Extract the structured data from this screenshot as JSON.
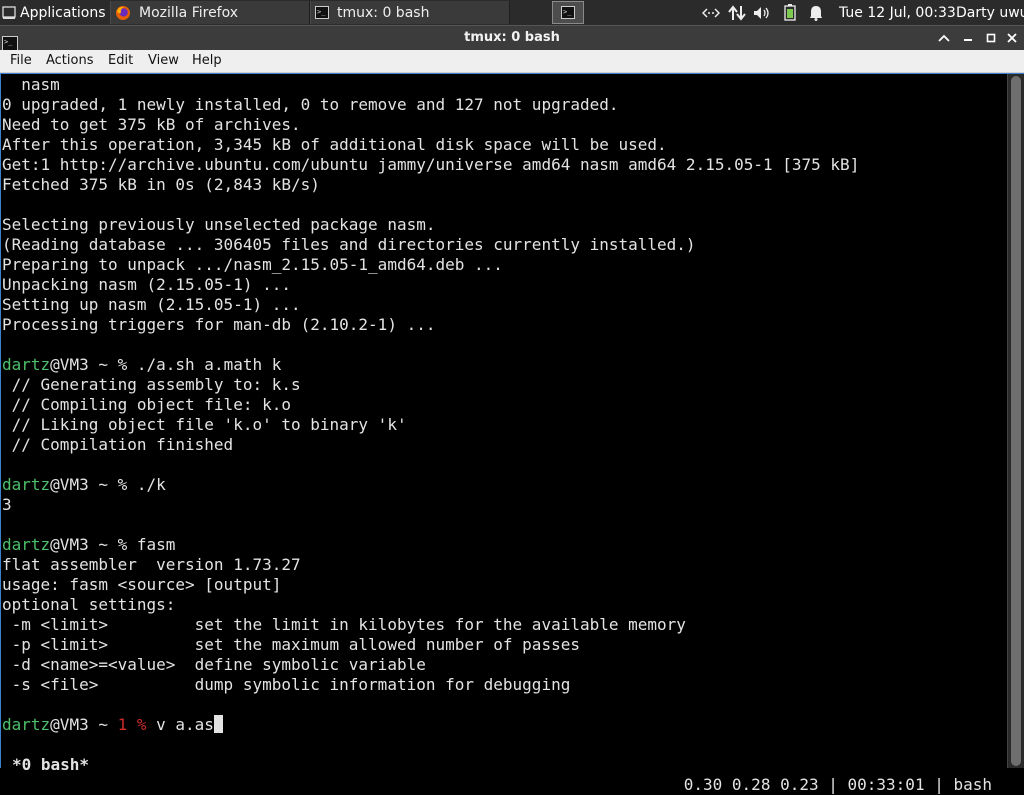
{
  "panel": {
    "applications_label": "Applications",
    "tasks": [
      {
        "label": "Mozilla Firefox",
        "icon": "firefox-icon"
      },
      {
        "label": "tmux: 0 bash",
        "icon": "terminal-icon"
      }
    ],
    "clock": "Tue 12 Jul, 00:33",
    "user": "Darty uwu"
  },
  "window": {
    "title": "tmux: 0 bash"
  },
  "menu": {
    "items": [
      "File",
      "Actions",
      "Edit",
      "View",
      "Help"
    ]
  },
  "terminal": {
    "lines": [
      "  nasm",
      "0 upgraded, 1 newly installed, 0 to remove and 127 not upgraded.",
      "Need to get 375 kB of archives.",
      "After this operation, 3,345 kB of additional disk space will be used.",
      "Get:1 http://archive.ubuntu.com/ubuntu jammy/universe amd64 nasm amd64 2.15.05-1 [375 kB]",
      "Fetched 375 kB in 0s (2,843 kB/s)",
      "",
      "Selecting previously unselected package nasm.",
      "(Reading database ... 306405 files and directories currently installed.)",
      "Preparing to unpack .../nasm_2.15.05-1_amd64.deb ...",
      "Unpacking nasm (2.15.05-1) ...",
      "Setting up nasm (2.15.05-1) ...",
      "Processing triggers for man-db (2.10.2-1) ...",
      "",
      "",
      " // Generating assembly to: k.s",
      " // Compiling object file: k.o",
      " // Liking object file 'k.o' to binary 'k'",
      " // Compilation finished",
      "",
      "",
      "3",
      "",
      "",
      "flat assembler  version 1.73.27",
      "usage: fasm <source> [output]",
      "optional settings:",
      " -m <limit>         set the limit in kilobytes for the available memory",
      " -p <limit>         set the maximum allowed number of passes",
      " -d <name>=<value>  define symbolic variable",
      " -s <file>          dump symbolic information for debugging",
      "",
      ""
    ],
    "prompts": [
      {
        "line": 14,
        "user": "dartz",
        "host": "@VM3 ~ % ",
        "command": "./a.sh a.math k"
      },
      {
        "line": 20,
        "user": "dartz",
        "host": "@VM3 ~ % ",
        "command": "./k"
      },
      {
        "line": 23,
        "user": "dartz",
        "host": "@VM3 ~ % ",
        "command": "fasm"
      }
    ],
    "current_prompt": {
      "user": "dartz",
      "host": "@VM3 ~ ",
      "exit_code": "1 % ",
      "input": "v a.as"
    }
  },
  "status": {
    "left": "*0 bash*",
    "right": "0.30 0.28 0.23 | 00:33:01 | bash"
  },
  "colors": {
    "prompt_user": "#4cbf6a",
    "prompt_error": "#cc2a2a",
    "terminal_fg": "#e3e3e3",
    "terminal_bg": "#000000",
    "panel_bg": "#2b2b2b",
    "accent": "#3b7fd0"
  }
}
